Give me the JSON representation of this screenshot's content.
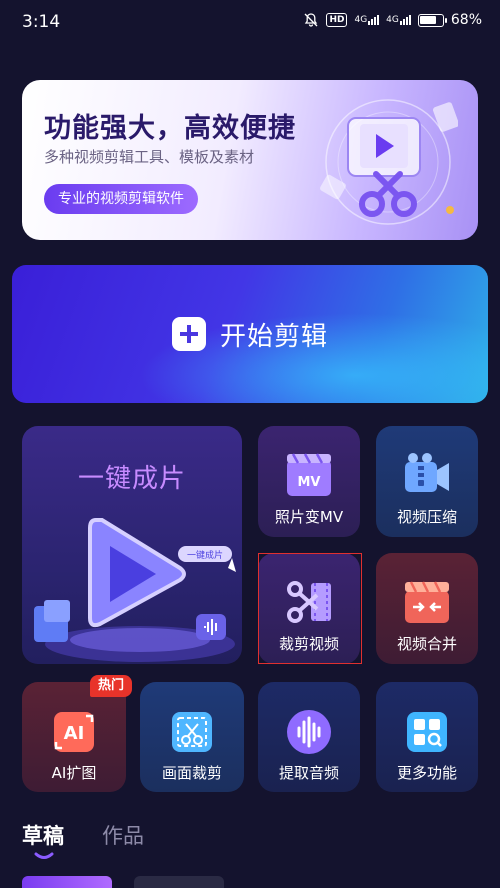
{
  "status_bar": {
    "time": "3:14",
    "network_1": "4G",
    "network_2": "4G",
    "hd_badge": "HD",
    "battery_percent": "68%",
    "battery_level": 0.68
  },
  "banner": {
    "title": "功能强大，高效便捷",
    "subtitle": "多种视频剪辑工具、模板及素材",
    "pill": "专业的视频剪辑软件"
  },
  "start_button": {
    "label": "开始剪辑"
  },
  "feature_card": {
    "title": "一键成片",
    "tag": "一键成片"
  },
  "tools": [
    {
      "label": "照片变MV",
      "icon": "mv-icon"
    },
    {
      "label": "视频压缩",
      "icon": "video-compress-icon"
    },
    {
      "label": "裁剪视频",
      "icon": "crop-video-icon"
    },
    {
      "label": "视频合并",
      "icon": "video-merge-icon"
    },
    {
      "label": "AI扩图",
      "icon": "ai-expand-icon"
    },
    {
      "label": "画面裁剪",
      "icon": "frame-crop-icon"
    },
    {
      "label": "提取音频",
      "icon": "extract-audio-icon"
    },
    {
      "label": "更多功能",
      "icon": "more-apps-icon"
    }
  ],
  "hot_badge": "热门",
  "tabs": [
    {
      "label": "草稿",
      "active": true
    },
    {
      "label": "作品",
      "active": false
    }
  ],
  "colors": {
    "background": "#14132e",
    "accent": "#6a3cf0",
    "hot": "#e8332a",
    "selection": "#e0302f"
  }
}
